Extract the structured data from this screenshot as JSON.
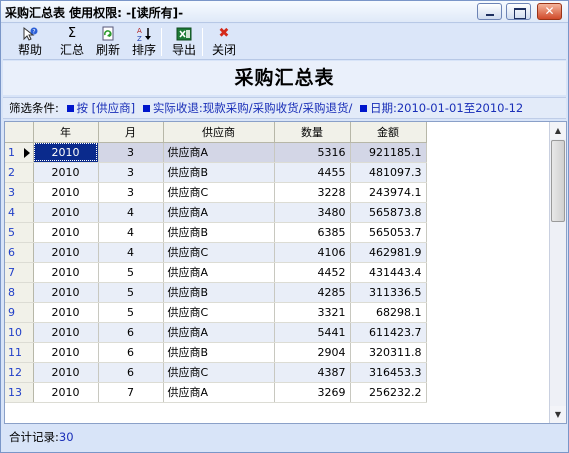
{
  "window": {
    "title": "采购汇总表  使用权限: -[读所有]-",
    "close_glyph": "✕"
  },
  "toolbar": {
    "help_label": "帮助",
    "sum_label": "汇总",
    "refresh_label": "刷新",
    "sort_label": "排序",
    "export_label": "导出",
    "close_label": "关闭",
    "sum_glyph": "Σ",
    "sort_glyph": "↓",
    "close_glyph": "✖"
  },
  "heading": "采购汇总表",
  "filters": {
    "label": "筛选条件:",
    "items": [
      "按 [供应商]",
      "实际收退:现款采购/采购收货/采购退货/",
      "日期:2010-01-01至2010-12"
    ]
  },
  "table": {
    "columns": [
      "年",
      "月",
      "供应商",
      "数量",
      "金额"
    ],
    "rows": [
      {
        "num": "1",
        "year": "2010",
        "month": "3",
        "supplier": "供应商A",
        "qty": "5316",
        "amount": "921185.1"
      },
      {
        "num": "2",
        "year": "2010",
        "month": "3",
        "supplier": "供应商B",
        "qty": "4455",
        "amount": "481097.3"
      },
      {
        "num": "3",
        "year": "2010",
        "month": "3",
        "supplier": "供应商C",
        "qty": "3228",
        "amount": "243974.1"
      },
      {
        "num": "4",
        "year": "2010",
        "month": "4",
        "supplier": "供应商A",
        "qty": "3480",
        "amount": "565873.8"
      },
      {
        "num": "5",
        "year": "2010",
        "month": "4",
        "supplier": "供应商B",
        "qty": "6385",
        "amount": "565053.7"
      },
      {
        "num": "6",
        "year": "2010",
        "month": "4",
        "supplier": "供应商C",
        "qty": "4106",
        "amount": "462981.9"
      },
      {
        "num": "7",
        "year": "2010",
        "month": "5",
        "supplier": "供应商A",
        "qty": "4452",
        "amount": "431443.4"
      },
      {
        "num": "8",
        "year": "2010",
        "month": "5",
        "supplier": "供应商B",
        "qty": "4285",
        "amount": "311336.5"
      },
      {
        "num": "9",
        "year": "2010",
        "month": "5",
        "supplier": "供应商C",
        "qty": "3321",
        "amount": "68298.1"
      },
      {
        "num": "10",
        "year": "2010",
        "month": "6",
        "supplier": "供应商A",
        "qty": "5441",
        "amount": "611423.7"
      },
      {
        "num": "11",
        "year": "2010",
        "month": "6",
        "supplier": "供应商B",
        "qty": "2904",
        "amount": "320311.8"
      },
      {
        "num": "12",
        "year": "2010",
        "month": "6",
        "supplier": "供应商C",
        "qty": "4387",
        "amount": "316453.3"
      },
      {
        "num": "13",
        "year": "2010",
        "month": "7",
        "supplier": "供应商A",
        "qty": "3269",
        "amount": "256232.2"
      }
    ]
  },
  "status": {
    "label": "合计记录:",
    "count": "30"
  }
}
